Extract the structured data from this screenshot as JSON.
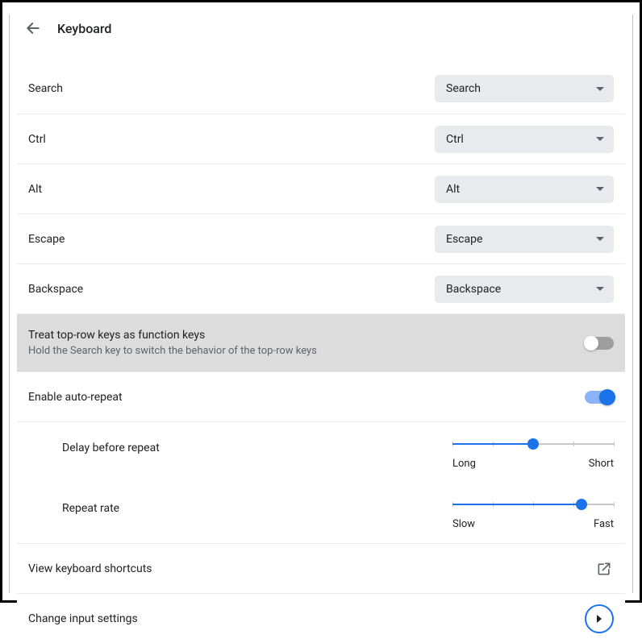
{
  "header": {
    "title": "Keyboard"
  },
  "keymap": [
    {
      "label": "Search",
      "value": "Search"
    },
    {
      "label": "Ctrl",
      "value": "Ctrl"
    },
    {
      "label": "Alt",
      "value": "Alt"
    },
    {
      "label": "Escape",
      "value": "Escape"
    },
    {
      "label": "Backspace",
      "value": "Backspace"
    }
  ],
  "toprow": {
    "label": "Treat top-row keys as function keys",
    "sublabel": "Hold the Search key to switch the behavior of the top-row keys",
    "enabled": false
  },
  "autorepeat": {
    "label": "Enable auto-repeat",
    "enabled": true
  },
  "delay": {
    "label": "Delay before repeat",
    "left": "Long",
    "right": "Short",
    "percent": 50
  },
  "rate": {
    "label": "Repeat rate",
    "left": "Slow",
    "right": "Fast",
    "percent": 80
  },
  "shortcuts": {
    "label": "View keyboard shortcuts"
  },
  "inputsettings": {
    "label": "Change input settings"
  }
}
